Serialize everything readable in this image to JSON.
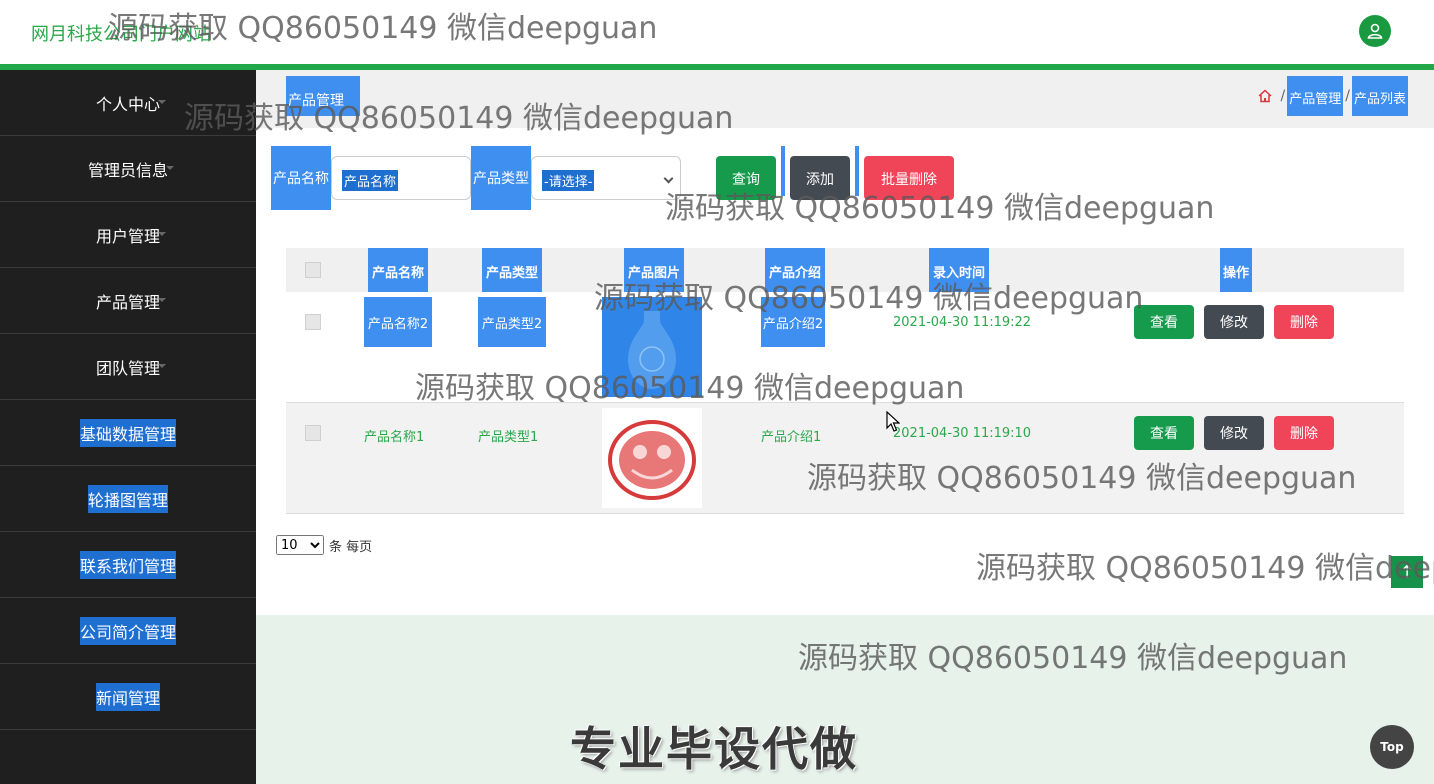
{
  "header": {
    "site_title": "网月科技公司门户网站"
  },
  "sidebar": {
    "items": [
      {
        "label": "个人中心",
        "highlighted": false
      },
      {
        "label": "管理员信息",
        "highlighted": false
      },
      {
        "label": "用户管理",
        "highlighted": false
      },
      {
        "label": "产品管理",
        "highlighted": false
      },
      {
        "label": "团队管理",
        "highlighted": false
      },
      {
        "label": "基础数据管理",
        "highlighted": true
      },
      {
        "label": "轮播图管理",
        "highlighted": true
      },
      {
        "label": "联系我们管理",
        "highlighted": true
      },
      {
        "label": "公司简介管理",
        "highlighted": true
      },
      {
        "label": "新闻管理",
        "highlighted": true
      }
    ]
  },
  "breadcrumb": {
    "title": "产品管理",
    "sep": "/",
    "items": [
      "产品管理",
      "产品列表"
    ]
  },
  "search": {
    "name_label": "产品名称",
    "name_placeholder": "产品名称",
    "type_label": "产品类型",
    "type_selected": "-请选择-",
    "query_button": "查询",
    "add_button": "添加",
    "batch_delete_button": "批量删除"
  },
  "table": {
    "headers": [
      "产品名称",
      "产品类型",
      "产品图片",
      "产品介绍",
      "录入时间",
      "操作"
    ],
    "rows": [
      {
        "name": "产品名称2",
        "type": "产品类型2",
        "intro": "产品介绍2",
        "time": "2021-04-30 11:19:22"
      },
      {
        "name": "产品名称1",
        "type": "产品类型1",
        "intro": "产品介绍1",
        "time": "2021-04-30 11:19:10"
      }
    ],
    "actions": {
      "view": "查看",
      "edit": "修改",
      "delete": "删除"
    }
  },
  "pager": {
    "page_size": "10",
    "suffix": "条 每页"
  },
  "footer": {
    "slogan": "专业毕设代做",
    "top_button": "Top",
    "back_up_button": "↑"
  },
  "watermark": {
    "text": "源码获取 QQ86050149 微信deepguan",
    "text_partial": "源码获取 QQ86050149 微信deep"
  },
  "colors": {
    "accent_green": "#22a848",
    "highlight_blue": "#3f8ff0",
    "sidebar_bg": "#1e1f1e",
    "danger": "#f04459",
    "dark_button": "#444a52"
  }
}
